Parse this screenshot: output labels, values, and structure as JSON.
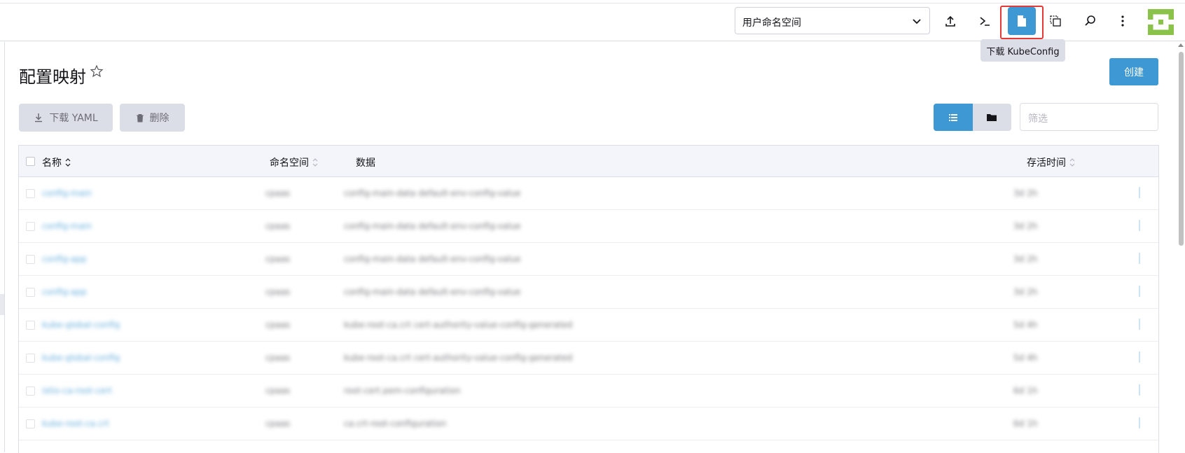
{
  "header": {
    "namespace_select": "用户命名空间",
    "tooltip": "下载 KubeConfig",
    "icons": [
      "upload-icon",
      "terminal-icon",
      "file-icon",
      "copy-icon",
      "search-icon",
      "more-vertical-icon"
    ],
    "accent": "#3d98d3"
  },
  "page": {
    "title": "配置映射",
    "create_label": "创建"
  },
  "toolbar": {
    "download_yaml": "下载 YAML",
    "delete": "删除",
    "filter_placeholder": "筛选"
  },
  "table": {
    "columns": {
      "name": "名称",
      "namespace": "命名空间",
      "data": "数据",
      "age": "存活时间"
    },
    "rows": [
      {
        "name": "config-main",
        "namespace": "cpaas",
        "data": "config-main-data default-env-config-value",
        "age": "3d 2h"
      },
      {
        "name": "config-main",
        "namespace": "cpaas",
        "data": "config-main-data default-env-config-value",
        "age": "3d 2h"
      },
      {
        "name": "config-app",
        "namespace": "cpaas",
        "data": "config-main-data default-env-config-value",
        "age": "3d 2h"
      },
      {
        "name": "config-app",
        "namespace": "cpaas",
        "data": "config-main-data default-env-config-value",
        "age": "3d 2h"
      },
      {
        "name": "kube-global-config",
        "namespace": "cpaas",
        "data": "kube-root-ca.crt cert-authority-value-config-generated",
        "age": "5d 4h"
      },
      {
        "name": "kube-global-config",
        "namespace": "cpaas",
        "data": "kube-root-ca.crt cert-authority-value-config-generated",
        "age": "5d 4h"
      },
      {
        "name": "istio-ca-root-cert",
        "namespace": "cpaas",
        "data": "root-cert.pem-configuration",
        "age": "6d 1h"
      },
      {
        "name": "kube-root-ca.crt",
        "namespace": "cpaas",
        "data": "ca.crt-root-configuration",
        "age": "6d 1h"
      }
    ]
  }
}
